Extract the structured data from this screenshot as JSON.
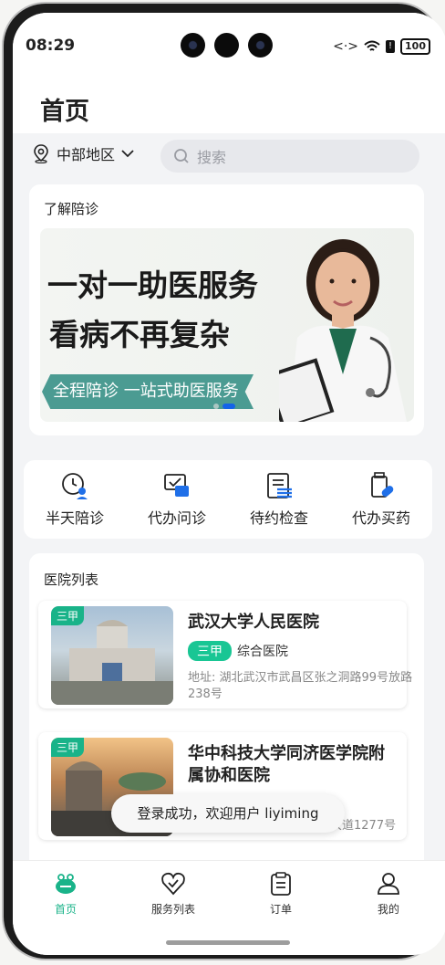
{
  "status": {
    "time": "08:29",
    "battery": "100"
  },
  "header": {
    "title": "首页"
  },
  "location": {
    "label": "中部地区"
  },
  "search": {
    "placeholder": "搜索"
  },
  "about": {
    "title": "了解陪诊",
    "banner": {
      "line1": "一对一助医服务",
      "line2": "看病不再复杂",
      "ribbon": "全程陪诊 一站式助医服务"
    }
  },
  "services": [
    {
      "label": "半天陪诊",
      "icon": "clock-person-icon"
    },
    {
      "label": "代办问诊",
      "icon": "chat-consult-icon"
    },
    {
      "label": "待约检查",
      "icon": "exam-list-icon"
    },
    {
      "label": "代办买药",
      "icon": "medicine-icon"
    }
  ],
  "hospital_list": {
    "title": "医院列表",
    "items": [
      {
        "badge": "三甲",
        "name": "武汉大学人民医院",
        "level": "三甲",
        "type": "综合医院",
        "address_label": "地址:",
        "address": "湖北武汉市武昌区张之洞路99号放路238号"
      },
      {
        "badge": "三甲",
        "name": "华中科技大学同济医学院附属协和医院",
        "address_tail": "大道1277号"
      }
    ]
  },
  "toast": {
    "text": "登录成功，欢迎用户 liyiming"
  },
  "tabbar": {
    "home": "首页",
    "services": "服务列表",
    "orders": "订单",
    "mine": "我的",
    "active_color": "#19b389"
  }
}
